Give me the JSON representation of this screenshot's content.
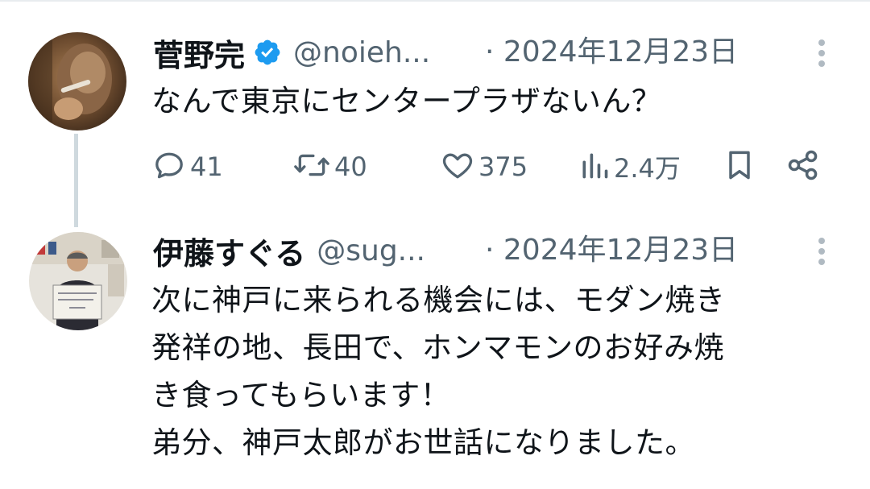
{
  "tweets": [
    {
      "author": "菅野完",
      "verified": true,
      "handle": "@noieh...",
      "date": "· 2024年12月23日",
      "text": "なんで東京にセンタープラザないん？",
      "actions": {
        "replies": "41",
        "retweets": "40",
        "likes": "375",
        "views": "2.4万"
      }
    },
    {
      "author": "伊藤すぐる",
      "verified": false,
      "handle": "@sug...",
      "date": "· 2024年12月23日",
      "text": "次に神戸に来られる機会には、モダン焼き\n発祥の地、長田で、ホンマモンのお好み焼\nき食ってもらいます！\n弟分、神戸太郎がお世話になりました。"
    }
  ],
  "icons": {
    "verified": "verified-badge-icon",
    "more": "more-vertical-icon",
    "reply": "reply-icon",
    "retweet": "retweet-icon",
    "like": "heart-icon",
    "views": "views-chart-icon",
    "bookmark": "bookmark-icon",
    "share": "share-icon"
  },
  "colors": {
    "text": "#0f1419",
    "secondary": "#536471",
    "verified_blue": "#1d9bf0",
    "thread_line": "#cfd9de"
  }
}
